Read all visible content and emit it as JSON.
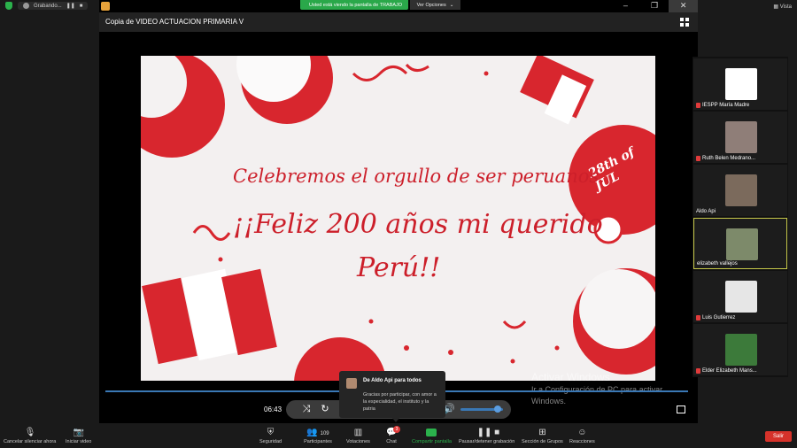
{
  "top": {
    "recording_label": "Grabando...",
    "share_banner": "Usted está viendo la pantalla de TRABAJO",
    "view_options": "Ver Opciones",
    "view_options_icon": "chevron-down-icon",
    "view_label": "Vista"
  },
  "window": {
    "title": "Copia de VIDEO ACTUACION PRIMARIA V",
    "minimize": "–",
    "maximize": "❐",
    "close": "✕"
  },
  "slide": {
    "line1": "Celebremos el orgullo de ser peruanos.",
    "line2": "¡¡Feliz 200 años mi querido",
    "line3": "Perú!!",
    "badge": "28th of JUL",
    "colors": {
      "red": "#cc1f2a",
      "bg": "#f3f0f0"
    }
  },
  "watermark": {
    "title": "Activar Windows",
    "subtitle": "Ir a Configuración de PC para activar Windows."
  },
  "player": {
    "time": "06:43",
    "progress": 1.0,
    "volume": 0.8
  },
  "chat_popup": {
    "from": "De Aldo Api para todos",
    "message": "Gracias por participar, con amor a la especialidad, el instituto y la patria"
  },
  "participants": [
    {
      "name": "IESPP María Madre",
      "muted": true,
      "color": "#ffffff"
    },
    {
      "name": "Ruth Belen Medrano...",
      "muted": true,
      "color": "#8f7e78"
    },
    {
      "name": "Aldo Api",
      "muted": false,
      "color": "#7b6a5c"
    },
    {
      "name": "elizabeth vallejos",
      "muted": false,
      "color": "#7d8a6a",
      "active": true
    },
    {
      "name": "Luis Gutierrez",
      "muted": true,
      "color": "#e6e6e6"
    },
    {
      "name": "Elder Elizabeth Mans...",
      "muted": true,
      "color": "#3c7a3a"
    }
  ],
  "toolbar": {
    "mute": "Cancelar silenciar ahora",
    "video": "Iniciar video",
    "security": "Seguridad",
    "participants": "Participantes",
    "participants_count": "109",
    "polls": "Votaciones",
    "chat": "Chat",
    "chat_badge": "3",
    "share": "Compartir pantalla",
    "record": "Pausar/detener grabación",
    "breakout": "Sección de Grupos",
    "reactions": "Reacciones",
    "leave": "Salir"
  }
}
